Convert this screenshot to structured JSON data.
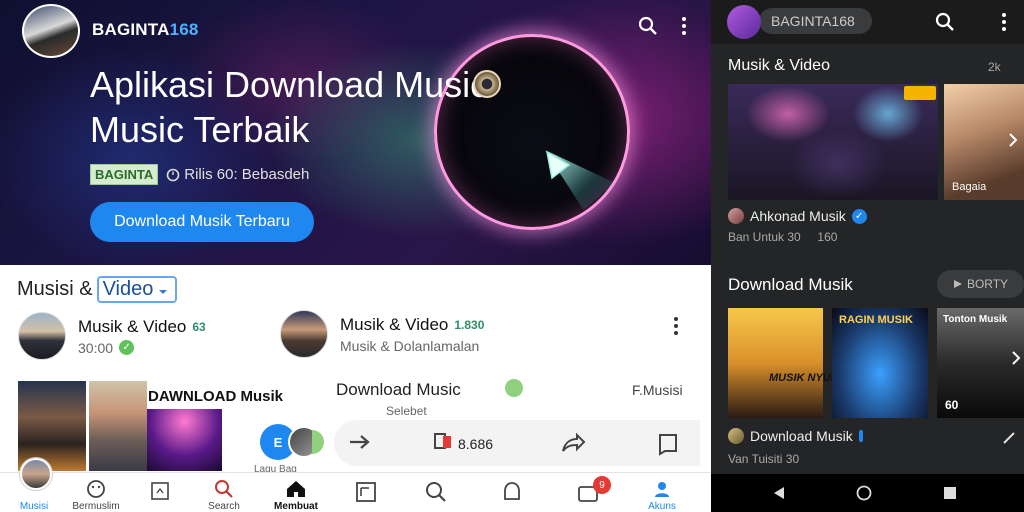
{
  "hero": {
    "brand_main": "BAGINTA",
    "brand_num": "168",
    "title_line1": "Aplikasi Download Music",
    "title_line2": "Music Terbaik",
    "tag": "BAGINTA",
    "info": "Rilis 60: Bebasdeh",
    "download_label": "Download Musik Terbaru"
  },
  "content": {
    "section_prefix": "Musisi &",
    "section_highlight": "Video",
    "channel1": {
      "name": "Musik & Video",
      "count": "63",
      "sub": "30:00"
    },
    "channel2": {
      "name": "Musik & Video",
      "count": "1.830",
      "sub": "Musik & Dolanlamalan"
    },
    "thumb_title": "DAWNLOAD Musik",
    "mid_title": "Download Music",
    "mid_sub": "Selebet",
    "mid_right": "F.Musisi",
    "dislike_count": "8.686",
    "float_label": "E",
    "small_caption": "Lagu Bag"
  },
  "nav": [
    {
      "label": "Musisi"
    },
    {
      "label": "Bermuslim"
    },
    {
      "label": ""
    },
    {
      "label": "Search"
    },
    {
      "label": "Membuat"
    },
    {
      "label": ""
    },
    {
      "label": ""
    },
    {
      "label": ""
    },
    {
      "label": ""
    },
    {
      "label": "Akuns"
    }
  ],
  "notif_count": "9",
  "right": {
    "search_text": "BAGINTA168",
    "sec1_title": "Musik & Video",
    "sec1_count": "2k",
    "card2_label": "Bagaia",
    "meta1_name": "Ahkonad Musik",
    "meta1_sub1": "Ban Untuk 30",
    "meta1_sub2": "160",
    "sec2_title": "Download Musik",
    "sec2_btn": "BORTY",
    "tile1_txt": "MUSIK NYUK",
    "tile2_txt": "RAGIN MUSIK",
    "tile3_txt": "Tonton Musik",
    "tile3_bottom": "60",
    "meta2_name": "Download Musik",
    "meta2_sub": "Van Tuisiti 30"
  }
}
